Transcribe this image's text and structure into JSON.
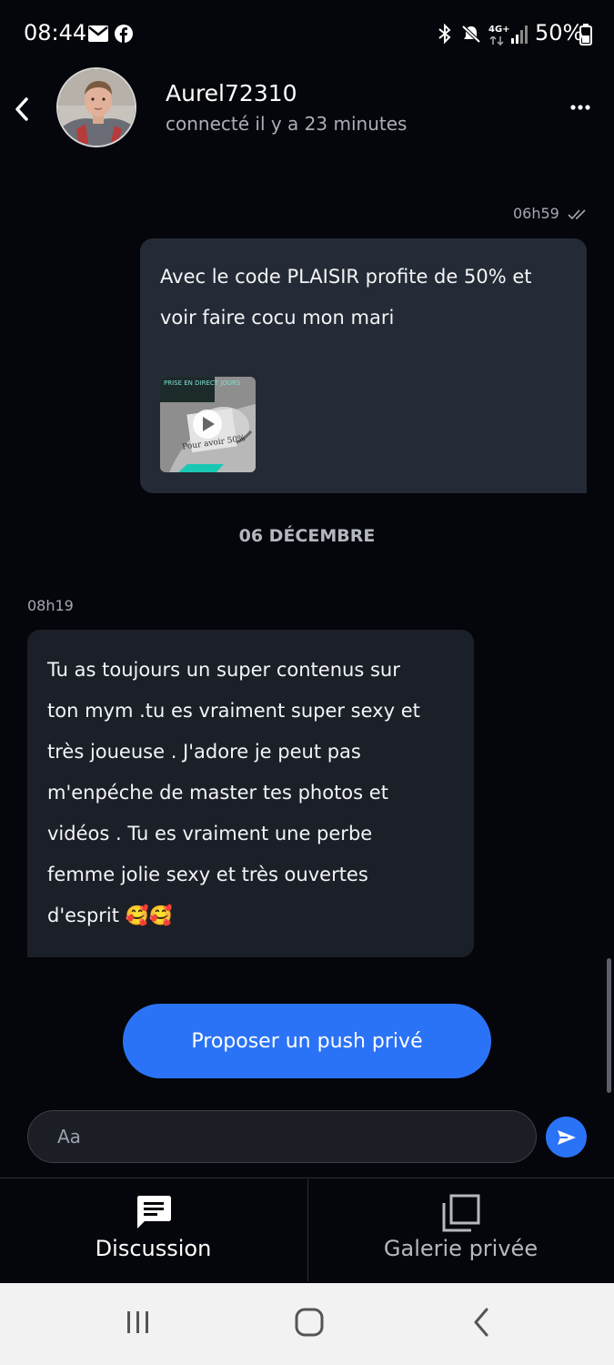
{
  "status_bar": {
    "time": "08:44",
    "battery": "50%",
    "network": "4G+",
    "left_icons": [
      "mail-icon",
      "facebook-icon"
    ],
    "right_icons": [
      "bluetooth-icon",
      "mute-icon",
      "network-icon",
      "signal-icon",
      "battery-icon"
    ]
  },
  "header": {
    "contact_name": "Aurel72310",
    "contact_status": "connecté il y a 23 minutes",
    "icons": [
      "back-icon",
      "more-icon"
    ]
  },
  "messages": [
    {
      "direction": "outgoing",
      "time": "06h59",
      "text": "Avec le code PLAISIR profite de 50% et\nvoir faire cocu mon mari",
      "read": true,
      "attachment": {
        "type": "video",
        "caption": "Pour avoir 50%",
        "overlay_text": "PRISE EN DIRECT JOURS"
      }
    },
    {
      "direction": "incoming",
      "time": "08h19",
      "text": "Tu as toujours un super contenus sur\nton mym .tu es vraiment super sexy et\ntrès joueuse . J'adore je peut pas\nm'enpéche de master tes photos et\nvidéos . Tu es vraiment une perbe\nfemme jolie sexy et très ouvertes\nd'esprit 🥰🥰"
    }
  ],
  "date_separator": "06 DÉCEMBRE",
  "push_button_label": "Proposer un push privé",
  "composer": {
    "placeholder": "Aa",
    "value": ""
  },
  "tabs": [
    {
      "label": "Discussion",
      "icon": "chat-icon",
      "active": true
    },
    {
      "label": "Galerie privée",
      "icon": "gallery-icon",
      "active": false
    }
  ],
  "colors": {
    "background": "#04060b",
    "accent": "#2b73f6",
    "bubble_outgoing": "#252b36",
    "bubble_incoming": "#1b1f28"
  }
}
